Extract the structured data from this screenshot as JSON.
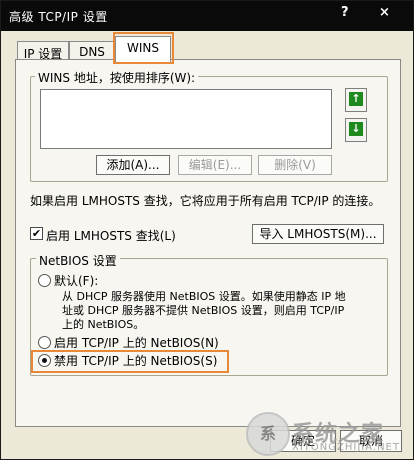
{
  "window": {
    "title": "高级 TCP/IP 设置",
    "help_glyph": "?",
    "close_glyph": "×"
  },
  "tabs": [
    {
      "label": "IP 设置"
    },
    {
      "label": "DNS"
    },
    {
      "label": "WINS"
    }
  ],
  "wins_group": {
    "legend": "WINS 地址，按使用排序(W):",
    "up_arrow": "↑",
    "down_arrow": "↓",
    "add_label": "添加(A)...",
    "edit_label": "编辑(E)...",
    "delete_label": "删除(V)"
  },
  "lmhosts": {
    "info": "如果启用 LMHOSTS 查找，它将应用于所有启用 TCP/IP 的连接。",
    "check_mark": "✔",
    "enable_label": "启用 LMHOSTS 查找(L)",
    "import_label": "导入 LMHOSTS(M)..."
  },
  "netbios": {
    "legend": "NetBIOS 设置",
    "default_label": "默认(F):",
    "default_desc_1": "从 DHCP 服务器使用 NetBIOS 设置。如果使用静态 IP 地",
    "default_desc_2": "址或 DHCP 服务器不提供 NetBIOS 设置，则启用 TCP/IP",
    "default_desc_3": "上的 NetBIOS。",
    "enable_label": "启用 TCP/IP 上的 NetBIOS(N)",
    "disable_label": "禁用 TCP/IP 上的 NetBIOS(S)",
    "selected": "disable"
  },
  "footer": {
    "ok_label": "确定",
    "cancel_label": "取消"
  },
  "watermark": {
    "text": "系统之家",
    "sub": "XITONGZHIJIA.NET",
    "mark": "系"
  }
}
